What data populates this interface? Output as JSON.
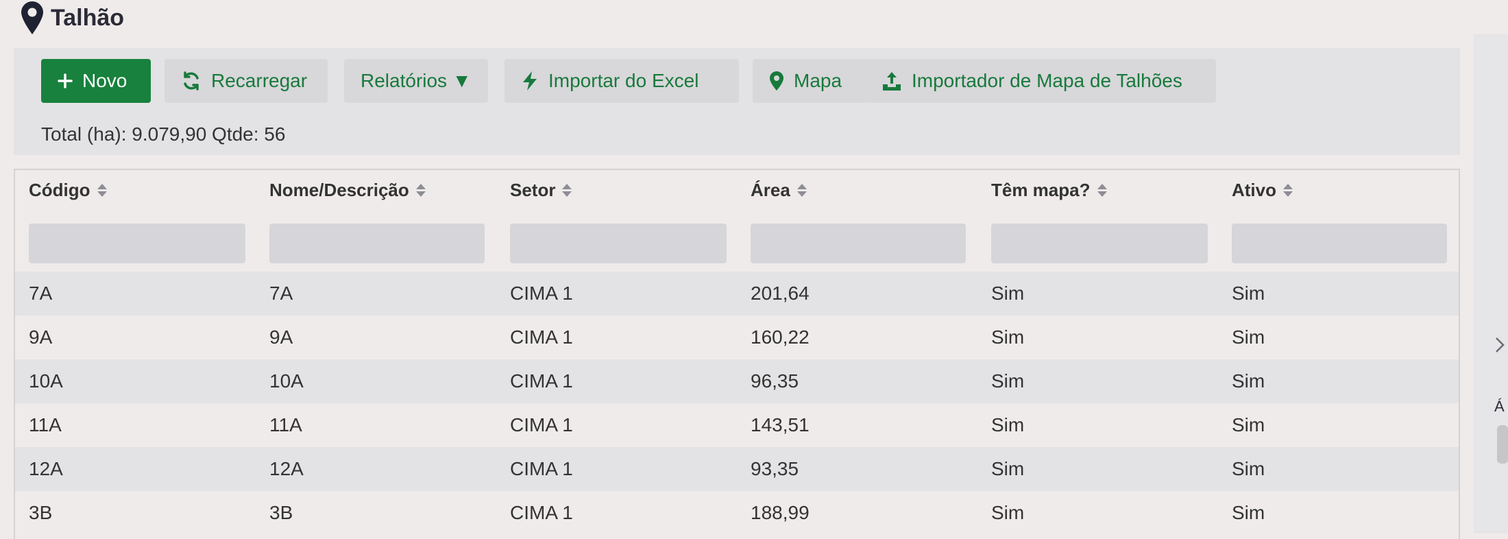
{
  "page": {
    "title": "Talhão",
    "icon": "map-pin-icon"
  },
  "toolbar": {
    "buttons": [
      {
        "label": "Novo",
        "icon": "plus-icon"
      },
      {
        "label": "Recarregar",
        "icon": "refresh-icon"
      },
      {
        "label": "Relatórios ▼",
        "icon": ""
      },
      {
        "label": "Importar do Excel",
        "icon": "lightning-icon"
      },
      {
        "label": "Mapa",
        "icon": "map-marker-icon"
      },
      {
        "label": "Importador de Mapa de Talhões",
        "icon": "upload-icon"
      }
    ],
    "total_text": "Total (ha): 9.079,90 Qtde: 56"
  },
  "table": {
    "columns": [
      "Código",
      "Nome/Descrição",
      "Setor",
      "Área",
      "Têm mapa?",
      "Ativo"
    ],
    "filters": [
      "",
      "",
      "",
      "",
      "",
      ""
    ],
    "rows": [
      [
        "7A",
        "7A",
        "CIMA 1",
        "201,64",
        "Sim",
        "Sim"
      ],
      [
        "9A",
        "9A",
        "CIMA 1",
        "160,22",
        "Sim",
        "Sim"
      ],
      [
        "10A",
        "10A",
        "CIMA 1",
        "96,35",
        "Sim",
        "Sim"
      ],
      [
        "11A",
        "11A",
        "CIMA 1",
        "143,51",
        "Sim",
        "Sim"
      ],
      [
        "12A",
        "12A",
        "CIMA 1",
        "93,35",
        "Sim",
        "Sim"
      ],
      [
        "3B",
        "3B",
        "CIMA 1",
        "188,99",
        "Sim",
        "Sim"
      ]
    ]
  },
  "sidebar_right": {
    "glyph": "Á"
  },
  "colors": {
    "accent": "#18813d",
    "accent_text": "#177a3c"
  }
}
